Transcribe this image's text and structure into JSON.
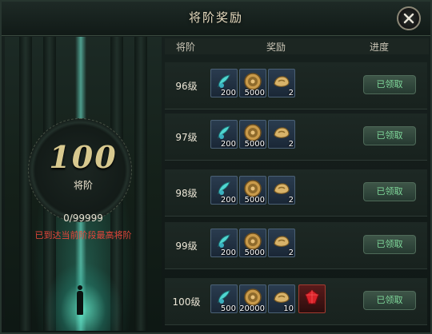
{
  "window": {
    "title": "将阶奖励"
  },
  "left_panel": {
    "rank_number": "100",
    "rank_label": "将阶",
    "progress": "0/99999",
    "max_message": "已到达当前阶段最高将阶"
  },
  "table": {
    "headers": {
      "level": "将阶",
      "rewards": "奖励",
      "progress": "进度"
    },
    "rows": [
      {
        "level": "96级",
        "rewards": [
          {
            "icon": "feather-scroll-icon",
            "qty": "200"
          },
          {
            "icon": "coin-icon",
            "qty": "5000"
          },
          {
            "icon": "gold-ingot-icon",
            "qty": "2"
          }
        ],
        "status": "已领取"
      },
      {
        "level": "97级",
        "rewards": [
          {
            "icon": "feather-scroll-icon",
            "qty": "200"
          },
          {
            "icon": "coin-icon",
            "qty": "5000"
          },
          {
            "icon": "gold-ingot-icon",
            "qty": "2"
          }
        ],
        "status": "已领取"
      },
      {
        "level": "98级",
        "rewards": [
          {
            "icon": "feather-scroll-icon",
            "qty": "200"
          },
          {
            "icon": "coin-icon",
            "qty": "5000"
          },
          {
            "icon": "gold-ingot-icon",
            "qty": "2"
          }
        ],
        "status": "已领取"
      },
      {
        "level": "99级",
        "rewards": [
          {
            "icon": "feather-scroll-icon",
            "qty": "200"
          },
          {
            "icon": "coin-icon",
            "qty": "5000"
          },
          {
            "icon": "gold-ingot-icon",
            "qty": "2"
          }
        ],
        "status": "已领取"
      },
      {
        "level": "100级",
        "rewards": [
          {
            "icon": "feather-scroll-icon",
            "qty": "500"
          },
          {
            "icon": "coin-icon",
            "qty": "20000"
          },
          {
            "icon": "gold-ingot-icon",
            "qty": "10"
          },
          {
            "icon": "red-gem-icon",
            "qty": ""
          }
        ],
        "status": "已领取"
      }
    ]
  },
  "colors": {
    "claimed_text": "#7fd89a",
    "max_message": "#e8453a",
    "rank_number": "#d8c98f"
  }
}
